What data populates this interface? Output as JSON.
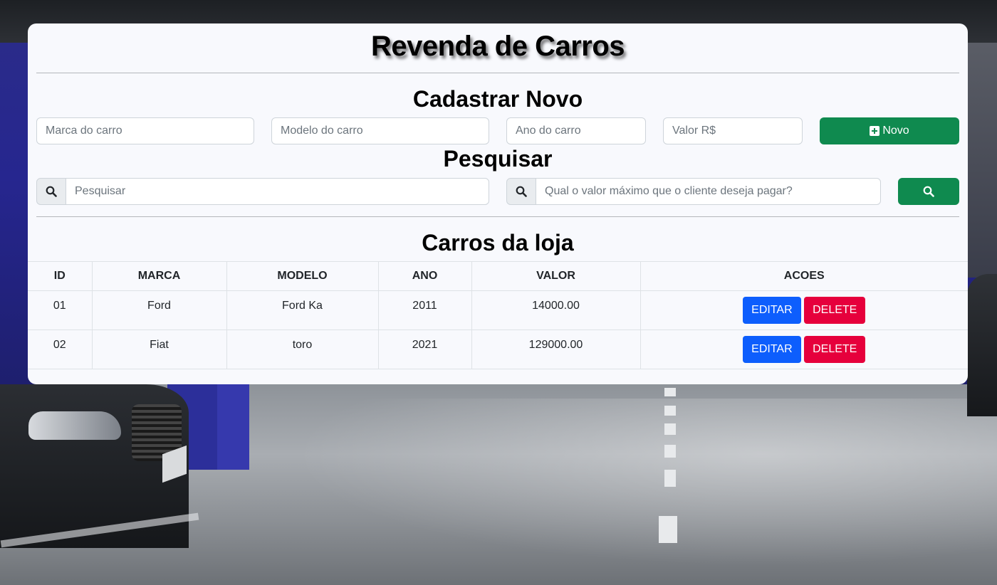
{
  "header": {
    "title": "Revenda de Carros"
  },
  "cadastrar": {
    "title": "Cadastrar Novo",
    "marca_placeholder": "Marca do carro",
    "modelo_placeholder": "Modelo do carro",
    "ano_placeholder": "Ano do carro",
    "valor_placeholder": "Valor R$",
    "novo_label": "Novo"
  },
  "pesquisar": {
    "title": "Pesquisar",
    "search_placeholder": "Pesquisar",
    "valor_max_placeholder": "Qual o valor máximo que o cliente deseja pagar?"
  },
  "table": {
    "title": "Carros da loja",
    "columns": [
      "ID",
      "MARCA",
      "MODELO",
      "ANO",
      "VALOR",
      "ACOES"
    ],
    "rows": [
      {
        "id": "01",
        "marca": "Ford",
        "modelo": "Ford Ka",
        "ano": "2011",
        "valor": "14000.00",
        "edit": "EDITAR",
        "delete": "DELETE"
      },
      {
        "id": "02",
        "marca": "Fiat",
        "modelo": "toro",
        "ano": "2021",
        "valor": "129000.00",
        "edit": "EDITAR",
        "delete": "DELETE"
      }
    ]
  },
  "colors": {
    "green": "#0f8a4f",
    "blue": "#0d5efd",
    "red": "#e6003c"
  },
  "icons": {
    "novo": "plus-square-icon",
    "search": "search-icon"
  }
}
